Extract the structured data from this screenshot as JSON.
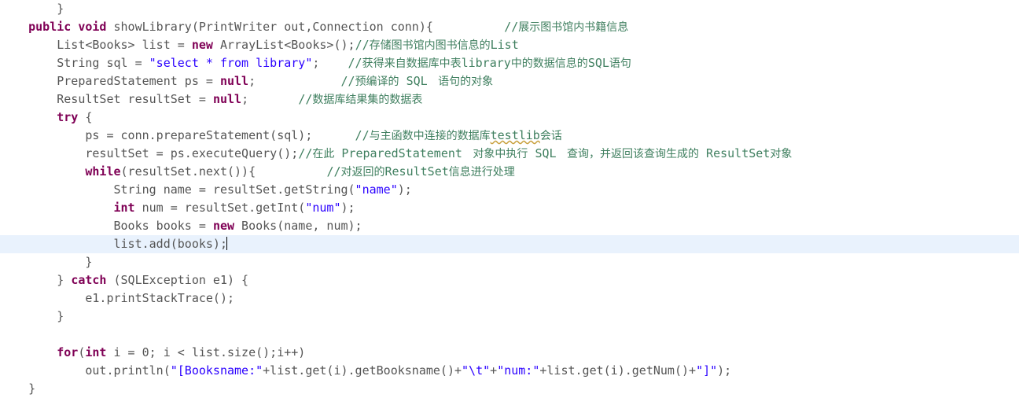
{
  "editor": {
    "language": "java",
    "theme": "eclipse-light",
    "colors": {
      "background": "#ffffff",
      "plain": "#555555",
      "keyword": "#7f0055",
      "string": "#2a00ff",
      "comment": "#3f7f5f",
      "current_line_highlight": "#e9f2fd",
      "caret": "#000000",
      "spellcheck_squiggle": "#c8a03c"
    },
    "caret_line_index": 11,
    "lines": [
      {
        "indent": "        ",
        "current": false,
        "clipped": true,
        "tokens": [
          {
            "type": "plain",
            "text": "}"
          }
        ]
      },
      {
        "indent": "    ",
        "current": false,
        "tokens": [
          {
            "type": "keyword",
            "text": "public void"
          },
          {
            "type": "plain",
            "text": " showLibrary(PrintWriter out,Connection conn){"
          },
          {
            "type": "plain",
            "text": "          "
          },
          {
            "type": "comment",
            "text": "//"
          },
          {
            "type": "comment-cjk",
            "text": "展示图书馆内书籍信息"
          }
        ]
      },
      {
        "indent": "        ",
        "current": false,
        "tokens": [
          {
            "type": "plain",
            "text": "List<Books> list = "
          },
          {
            "type": "keyword",
            "text": "new"
          },
          {
            "type": "plain",
            "text": " ArrayList<Books>();"
          },
          {
            "type": "comment",
            "text": "//"
          },
          {
            "type": "comment-cjk",
            "text": "存储图书馆内图书信息的"
          },
          {
            "type": "comment",
            "text": "List"
          }
        ]
      },
      {
        "indent": "        ",
        "current": false,
        "tokens": [
          {
            "type": "plain",
            "text": "String sql = "
          },
          {
            "type": "string",
            "text": "\"select * from library\""
          },
          {
            "type": "plain",
            "text": ";    "
          },
          {
            "type": "comment",
            "text": "//"
          },
          {
            "type": "comment-cjk",
            "text": "获得来自数据库中表"
          },
          {
            "type": "comment",
            "text": "library"
          },
          {
            "type": "comment-cjk",
            "text": "中的数据信息的"
          },
          {
            "type": "comment",
            "text": "SQL"
          },
          {
            "type": "comment-cjk",
            "text": "语句"
          }
        ]
      },
      {
        "indent": "        ",
        "current": false,
        "tokens": [
          {
            "type": "plain",
            "text": "PreparedStatement ps = "
          },
          {
            "type": "keyword",
            "text": "null"
          },
          {
            "type": "plain",
            "text": ";            "
          },
          {
            "type": "comment",
            "text": "//"
          },
          {
            "type": "comment-cjk",
            "text": "预编译的"
          },
          {
            "type": "comment",
            "text": " SQL "
          },
          {
            "type": "comment-cjk",
            "text": " 语句的对象"
          }
        ]
      },
      {
        "indent": "        ",
        "current": false,
        "tokens": [
          {
            "type": "plain",
            "text": "ResultSet resultSet = "
          },
          {
            "type": "keyword",
            "text": "null"
          },
          {
            "type": "plain",
            "text": ";       "
          },
          {
            "type": "comment",
            "text": "//"
          },
          {
            "type": "comment-cjk",
            "text": "数据库结果集的数据表"
          }
        ]
      },
      {
        "indent": "        ",
        "current": false,
        "tokens": [
          {
            "type": "keyword",
            "text": "try"
          },
          {
            "type": "plain",
            "text": " {"
          }
        ]
      },
      {
        "indent": "            ",
        "current": false,
        "tokens": [
          {
            "type": "plain",
            "text": "ps = conn.prepareStatement(sql);    "
          },
          {
            "type": "comment",
            "text": "  //"
          },
          {
            "type": "comment-cjk",
            "text": "与主函数中连接的数据库"
          },
          {
            "type": "misspelled",
            "text": "testlib"
          },
          {
            "type": "comment-cjk",
            "text": "会话"
          }
        ]
      },
      {
        "indent": "            ",
        "current": false,
        "tokens": [
          {
            "type": "plain",
            "text": "resultSet = ps.executeQuery();"
          },
          {
            "type": "comment",
            "text": "//"
          },
          {
            "type": "comment-cjk",
            "text": "在此"
          },
          {
            "type": "comment",
            "text": " PreparedStatement "
          },
          {
            "type": "comment-cjk",
            "text": " 对象中执行"
          },
          {
            "type": "comment",
            "text": " SQL "
          },
          {
            "type": "comment-cjk",
            "text": " 查询，并返回该查询生成的"
          },
          {
            "type": "comment",
            "text": " ResultSet"
          },
          {
            "type": "comment-cjk",
            "text": "对象"
          }
        ]
      },
      {
        "indent": "            ",
        "current": false,
        "tokens": [
          {
            "type": "keyword",
            "text": "while"
          },
          {
            "type": "plain",
            "text": "(resultSet.next()){"
          },
          {
            "type": "plain",
            "text": "          "
          },
          {
            "type": "comment",
            "text": "//"
          },
          {
            "type": "comment-cjk",
            "text": "对返回的"
          },
          {
            "type": "comment",
            "text": "ResultSet"
          },
          {
            "type": "comment-cjk",
            "text": "信息进行处理"
          }
        ]
      },
      {
        "indent": "                ",
        "current": false,
        "tokens": [
          {
            "type": "plain",
            "text": "String name = resultSet.getString("
          },
          {
            "type": "string",
            "text": "\"name\""
          },
          {
            "type": "plain",
            "text": ");"
          }
        ]
      },
      {
        "indent": "                ",
        "current": false,
        "tokens": [
          {
            "type": "keyword",
            "text": "int"
          },
          {
            "type": "plain",
            "text": " num = resultSet.getInt("
          },
          {
            "type": "string",
            "text": "\"num\""
          },
          {
            "type": "plain",
            "text": ");"
          }
        ]
      },
      {
        "indent": "                ",
        "current": false,
        "tokens": [
          {
            "type": "plain",
            "text": "Books books = "
          },
          {
            "type": "keyword",
            "text": "new"
          },
          {
            "type": "plain",
            "text": " Books(name, num);"
          }
        ]
      },
      {
        "indent": "                ",
        "current": true,
        "caret": true,
        "tokens": [
          {
            "type": "plain",
            "text": "list.add(books);"
          }
        ]
      },
      {
        "indent": "            ",
        "current": false,
        "tokens": [
          {
            "type": "plain",
            "text": "}"
          }
        ]
      },
      {
        "indent": "        ",
        "current": false,
        "tokens": [
          {
            "type": "plain",
            "text": "} "
          },
          {
            "type": "keyword",
            "text": "catch"
          },
          {
            "type": "plain",
            "text": " (SQLException e1) {"
          }
        ]
      },
      {
        "indent": "            ",
        "current": false,
        "tokens": [
          {
            "type": "plain",
            "text": "e1.printStackTrace();"
          }
        ]
      },
      {
        "indent": "        ",
        "current": false,
        "tokens": [
          {
            "type": "plain",
            "text": "}"
          }
        ]
      },
      {
        "indent": "",
        "current": false,
        "tokens": []
      },
      {
        "indent": "        ",
        "current": false,
        "tokens": [
          {
            "type": "keyword",
            "text": "for"
          },
          {
            "type": "plain",
            "text": "("
          },
          {
            "type": "keyword",
            "text": "int"
          },
          {
            "type": "plain",
            "text": " i = 0; i < list.size();i++)"
          }
        ]
      },
      {
        "indent": "            ",
        "current": false,
        "tokens": [
          {
            "type": "plain",
            "text": "out.println("
          },
          {
            "type": "string",
            "text": "\"[Booksname:\""
          },
          {
            "type": "plain",
            "text": "+list.get(i).getBooksname()+"
          },
          {
            "type": "string",
            "text": "\"\\t\""
          },
          {
            "type": "plain",
            "text": "+"
          },
          {
            "type": "string",
            "text": "\"num:\""
          },
          {
            "type": "plain",
            "text": "+list.get(i).getNum()+"
          },
          {
            "type": "string",
            "text": "\"]\""
          },
          {
            "type": "plain",
            "text": ");"
          }
        ]
      },
      {
        "indent": "    ",
        "current": false,
        "tokens": [
          {
            "type": "plain",
            "text": "}"
          }
        ]
      }
    ]
  }
}
